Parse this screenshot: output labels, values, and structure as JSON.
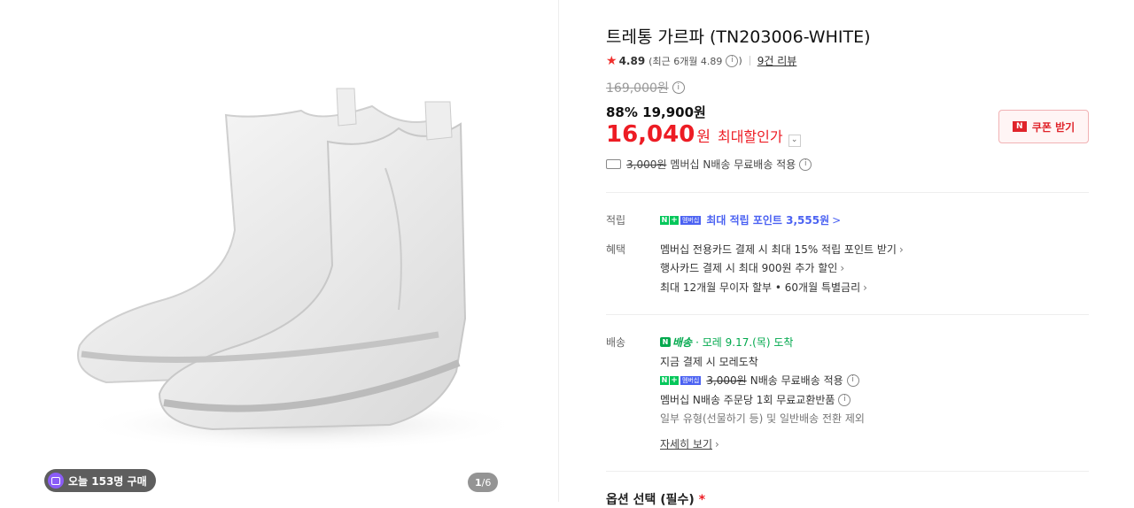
{
  "colors": {
    "price_red": "#ed1c24",
    "naver_green": "#03c75a",
    "member_blue": "#4b62f2"
  },
  "gallery": {
    "today_badge": "오늘 153명 구매",
    "pager_current": "1",
    "pager_total": "/6"
  },
  "product": {
    "title": "트레통 가르파 (TN203006-WHITE)",
    "rating": "4.89",
    "rating_recent": "(최근 6개월 4.89",
    "rating_recent_close": ")",
    "review_link": "9건 리뷰",
    "original_price": "169,000원",
    "discount_line": "88% 19,900원",
    "max_price": "16,040",
    "max_price_won": "원",
    "max_price_label": "최대할인가",
    "coupon_button": "쿠폰 받기",
    "coupon_badge": "N",
    "shipping_orig": "3,000원",
    "shipping_text": "멤버십 N배송 무료배송 적용"
  },
  "points": {
    "label": "적립",
    "text": "최대 적립 포인트 3,555원",
    "arrow": ">"
  },
  "benefits": {
    "label": "혜택",
    "items": [
      "멤버십 전용카드 결제 시 최대 15% 적립 포인트 받기",
      "행사카드 결제 시 최대 900원 추가 할인",
      "최대 12개월 무이자 할부 • 60개월 특별금리"
    ]
  },
  "delivery": {
    "label": "배송",
    "badge": "배송",
    "arrival": "· 모레 9.17.(목) 도착",
    "line1": "지금 결제 시 모레도착",
    "line2_orig": "3,000원",
    "line2": "N배송 무료배송 적용",
    "line3": "멤버십 N배송 주문당 1회 무료교환반품",
    "line4": "일부 유형(선물하기 등) 및 일반배송 전환 제외",
    "details_link": "자세히 보기"
  },
  "membership_badge": {
    "n": "N",
    "plus": "+",
    "label": "멤버십"
  },
  "options": {
    "label": "옵션 선택 (필수)",
    "required": "*"
  }
}
